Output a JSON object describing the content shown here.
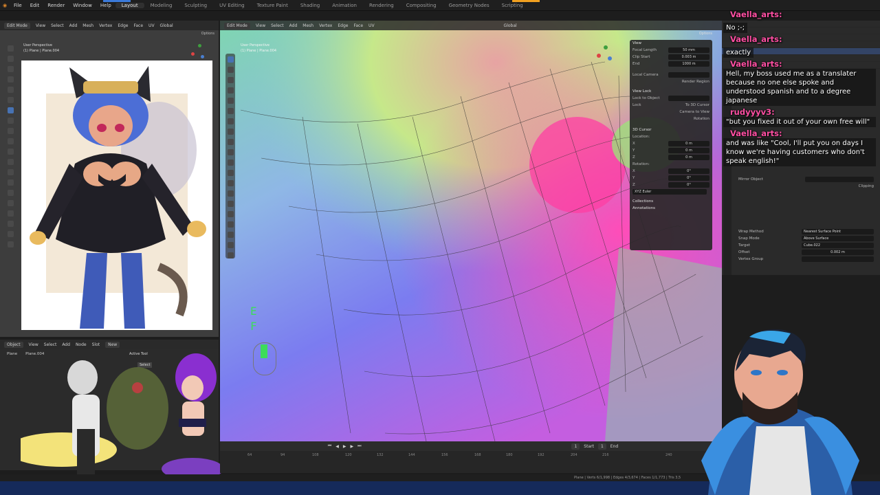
{
  "menu": [
    "File",
    "Edit",
    "Render",
    "Window",
    "Help"
  ],
  "workspaces": [
    "Layout",
    "Modeling",
    "Sculpting",
    "UV Editing",
    "Texture Paint",
    "Shading",
    "Animation",
    "Rendering",
    "Compositing",
    "Geometry Nodes",
    "Scripting"
  ],
  "left_viewport": {
    "mode": "Edit Mode",
    "menus": [
      "View",
      "Select",
      "Add",
      "Mesh",
      "Vertex",
      "Edge",
      "Face",
      "UV"
    ],
    "global": "Global",
    "perspective": "User Perspective",
    "object_label": "(1) Plane | Plane.004",
    "options": "Options"
  },
  "main_viewport": {
    "mode": "Edit Mode",
    "menus": [
      "View",
      "Select",
      "Add",
      "Mesh",
      "Vertex",
      "Edge",
      "Face",
      "UV"
    ],
    "global": "Global",
    "options": "Options",
    "perspective": "User Perspective",
    "object_label": "(1) Plane | Plane.004",
    "key_overlay": [
      "E",
      "F"
    ]
  },
  "n_panel": {
    "view_title": "View",
    "focal_length_label": "Focal Length",
    "focal_length": "50 mm",
    "clip_start_label": "Clip Start",
    "clip_start": "0.003 m",
    "clip_end_label": "End",
    "clip_end": "1000 m",
    "local_camera": "Local Camera",
    "render_region": "Render Region",
    "view_lock_title": "View Lock",
    "lock_to_object": "Lock to Object",
    "lock_label": "Lock",
    "to_3d_cursor": "To 3D Cursor",
    "camera_to_view": "Camera to View",
    "rotation": "Rotation",
    "cursor_title": "3D Cursor",
    "location_label": "Location:",
    "axes": [
      "X",
      "Y",
      "Z"
    ],
    "zero_m": "0 m",
    "rotation_label": "Rotation:",
    "zero_deg": "0°",
    "euler": "XYZ Euler",
    "collections": "Collections",
    "annotations": "Annotations"
  },
  "modifier_panel": {
    "wrap_method_label": "Wrap Method",
    "wrap_method": "Nearest Surface Point",
    "snap_mode_label": "Snap Mode",
    "snap_mode": "Above Surface",
    "target_label": "Target",
    "target": "Cube.022",
    "offset_label": "Offset",
    "offset": "0.002 m",
    "vertex_group_label": "Vertex Group",
    "mirror_object": "Mirror Object",
    "clipping": "Clipping"
  },
  "node_editor": {
    "object": "Object",
    "menus": [
      "View",
      "Select",
      "Add",
      "Node"
    ],
    "slot": "Slot",
    "new_btn": "New",
    "breadcrumb_plane": "Plane",
    "breadcrumb_mesh": "Plane.004",
    "active_tool": "Active Tool",
    "select": "Select"
  },
  "timeline": {
    "start_label": "Start",
    "start": "1",
    "end_label": "End",
    "frame": "1",
    "ticks": [
      "64",
      "94",
      "108",
      "120",
      "132",
      "144",
      "156",
      "168",
      "180",
      "192",
      "204",
      "216",
      "240"
    ]
  },
  "status_bar": "Plane | Verts 6/1,998 | Edges 4/3,674 | Faces 1/1,773 | Tris 3,5",
  "chat": [
    {
      "name": "Vaella_arts:",
      "msg": "No ;-;",
      "name_color": "#ff4fa3"
    },
    {
      "name": "Vaella_arts:",
      "msg": "exactly",
      "name_color": "#ff4fa3"
    },
    {
      "name": "Vaella_arts:",
      "msg": "Hell, my boss used me as a translater because no one else spoke and understood spanish and to a degree japanese",
      "name_color": "#ff4fa3"
    },
    {
      "name": "rudyyyv3:",
      "msg": "\"but you fixed it out of your own free will\"",
      "name_color": "#ff4fa3"
    },
    {
      "name": "Vaella_arts:",
      "msg": "and was like \"Cool, I'll put you on days I know we're having customers who don't speak english!\"",
      "name_color": "#ff4fa3"
    }
  ],
  "colors": {
    "accent": "#4772b3",
    "chat_name": "#ff4fa3",
    "key_overlay": "#3ddc5a"
  }
}
